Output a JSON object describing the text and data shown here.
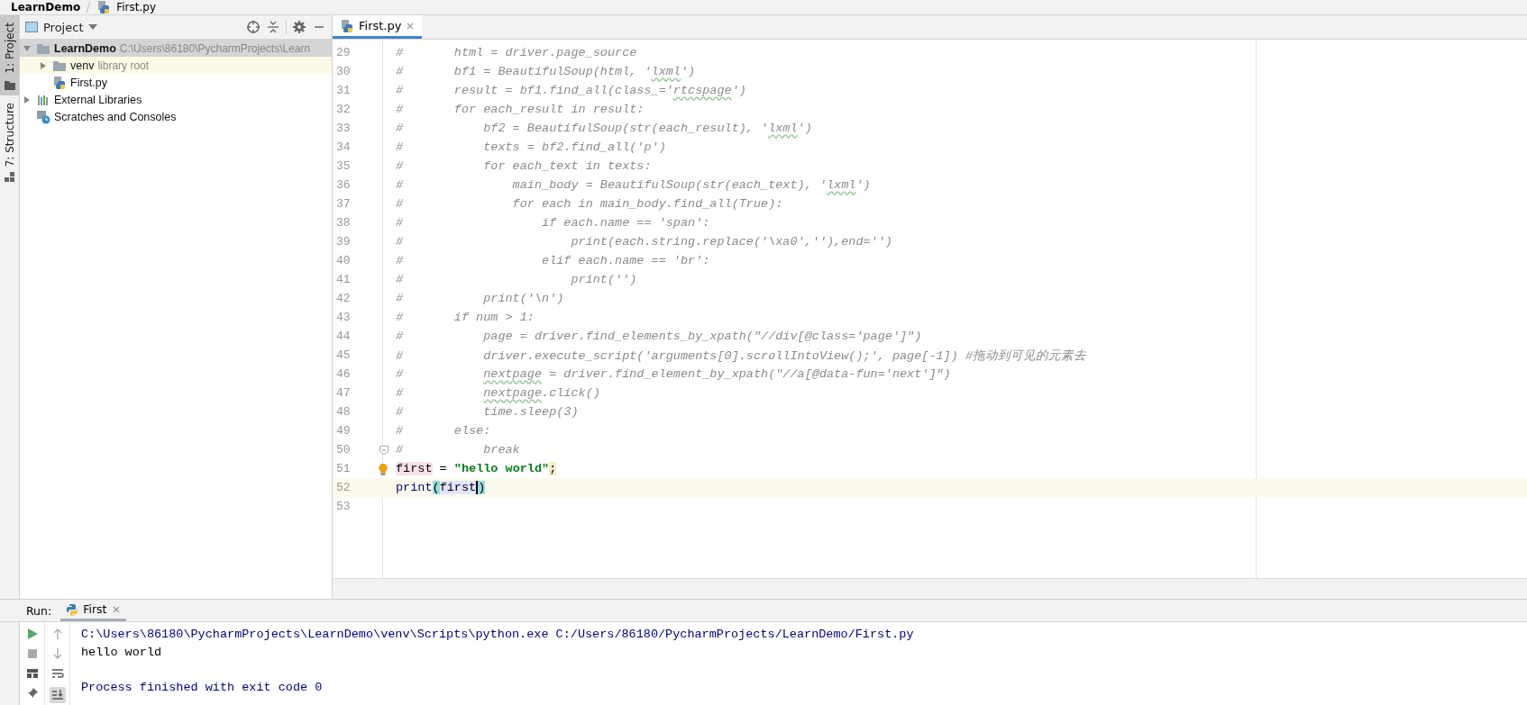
{
  "breadcrumb": [
    "LearnDemo",
    "First.py"
  ],
  "tool_strip": [
    {
      "label": "1: Project",
      "selected": true
    },
    {
      "label": "7: Structure",
      "selected": false
    }
  ],
  "project_panel": {
    "title": "Project",
    "tree": [
      {
        "name": "LearnDemo",
        "kind": "project-folder",
        "path": "C:\\Users\\86180\\PycharmProjects\\Learn",
        "expanded": true,
        "selected": true,
        "children": [
          {
            "name": "venv",
            "kind": "folder",
            "note": "library root",
            "expanded": false,
            "selected": false
          },
          {
            "name": "First.py",
            "kind": "python-file",
            "selected": false
          }
        ]
      },
      {
        "name": "External Libraries",
        "kind": "libraries",
        "expanded": false,
        "selected": false
      },
      {
        "name": "Scratches and Consoles",
        "kind": "scratches",
        "selected": false
      }
    ]
  },
  "editor": {
    "tabs": [
      {
        "label": "First.py",
        "selected": true
      }
    ],
    "lines": [
      {
        "number": "29",
        "current": false,
        "segments": [
          {
            "kind": "comment",
            "text": "#       html = driver.page_source"
          }
        ]
      },
      {
        "number": "30",
        "current": false,
        "segments": [
          {
            "kind": "comment",
            "text": "#       bf1 = BeautifulSoup(html, '"
          },
          {
            "kind": "typo",
            "text": "lxml"
          },
          {
            "kind": "comment",
            "text": "')"
          }
        ]
      },
      {
        "number": "31",
        "current": false,
        "segments": [
          {
            "kind": "comment",
            "text": "#       result = bf1.find_all(class_='"
          },
          {
            "kind": "typo",
            "text": "rtcspage"
          },
          {
            "kind": "comment",
            "text": "')"
          }
        ]
      },
      {
        "number": "32",
        "current": false,
        "segments": [
          {
            "kind": "comment",
            "text": "#       for each_result in result:"
          }
        ]
      },
      {
        "number": "33",
        "current": false,
        "segments": [
          {
            "kind": "comment",
            "text": "#           bf2 = BeautifulSoup(str(each_result), '"
          },
          {
            "kind": "typo",
            "text": "lxml"
          },
          {
            "kind": "comment",
            "text": "')"
          }
        ]
      },
      {
        "number": "34",
        "current": false,
        "segments": [
          {
            "kind": "comment",
            "text": "#           texts = bf2.find_all('p')"
          }
        ]
      },
      {
        "number": "35",
        "current": false,
        "segments": [
          {
            "kind": "comment",
            "text": "#           for each_text in texts:"
          }
        ]
      },
      {
        "number": "36",
        "current": false,
        "segments": [
          {
            "kind": "comment",
            "text": "#               main_body = BeautifulSoup(str(each_text), '"
          },
          {
            "kind": "typo",
            "text": "lxml"
          },
          {
            "kind": "comment",
            "text": "')"
          }
        ]
      },
      {
        "number": "37",
        "current": false,
        "segments": [
          {
            "kind": "comment",
            "text": "#               for each in main_body.find_all(True):"
          }
        ]
      },
      {
        "number": "38",
        "current": false,
        "segments": [
          {
            "kind": "comment",
            "text": "#                   if each.name == 'span':"
          }
        ]
      },
      {
        "number": "39",
        "current": false,
        "segments": [
          {
            "kind": "comment",
            "text": "#                       print(each.string.replace('\\xa0',''),end='')"
          }
        ]
      },
      {
        "number": "40",
        "current": false,
        "segments": [
          {
            "kind": "comment",
            "text": "#                   elif each.name == 'br':"
          }
        ]
      },
      {
        "number": "41",
        "current": false,
        "segments": [
          {
            "kind": "comment",
            "text": "#                       print('')"
          }
        ]
      },
      {
        "number": "42",
        "current": false,
        "segments": [
          {
            "kind": "comment",
            "text": "#           print('\\n')"
          }
        ]
      },
      {
        "number": "43",
        "current": false,
        "segments": [
          {
            "kind": "comment",
            "text": "#       if num > 1:"
          }
        ]
      },
      {
        "number": "44",
        "current": false,
        "segments": [
          {
            "kind": "comment",
            "text": "#           page = driver.find_elements_by_xpath(\"//div[@class='page']\")"
          }
        ]
      },
      {
        "number": "45",
        "current": false,
        "segments": [
          {
            "kind": "comment",
            "text": "#           driver.execute_script('arguments[0].scrollIntoView();', page[-1]) #拖动到可见的元素去"
          }
        ]
      },
      {
        "number": "46",
        "current": false,
        "segments": [
          {
            "kind": "comment",
            "text": "#           "
          },
          {
            "kind": "typo",
            "text": "nextpage"
          },
          {
            "kind": "comment",
            "text": " = driver.find_element_by_xpath(\"//a[@data-fun='next']\")"
          }
        ]
      },
      {
        "number": "47",
        "current": false,
        "segments": [
          {
            "kind": "comment",
            "text": "#           "
          },
          {
            "kind": "typo",
            "text": "nextpage"
          },
          {
            "kind": "comment",
            "text": ".click()"
          }
        ]
      },
      {
        "number": "48",
        "current": false,
        "segments": [
          {
            "kind": "comment",
            "text": "#           time.sleep(3)"
          }
        ]
      },
      {
        "number": "49",
        "current": false,
        "segments": [
          {
            "kind": "comment",
            "text": "#       else:"
          }
        ]
      },
      {
        "number": "50",
        "current": false,
        "fold": true,
        "segments": [
          {
            "kind": "comment",
            "text": "#           break"
          }
        ]
      },
      {
        "number": "51",
        "current": false,
        "intention": true,
        "segments": [
          {
            "kind": "write-usage",
            "text": "first"
          },
          {
            "kind": "plain",
            "text": " = "
          },
          {
            "kind": "string",
            "text": "\"hello world\""
          },
          {
            "kind": "warning",
            "text": ";"
          }
        ]
      },
      {
        "number": "52",
        "current": true,
        "segments": [
          {
            "kind": "builtin",
            "text": "print"
          },
          {
            "kind": "brace",
            "text": "("
          },
          {
            "kind": "read-usage",
            "text": "first",
            "caret": true
          },
          {
            "kind": "brace",
            "text": ")"
          }
        ]
      },
      {
        "number": "53",
        "current": false
      }
    ]
  },
  "run_panel": {
    "title": "Run:",
    "tabs": [
      {
        "label": "First",
        "selected": true
      }
    ],
    "output": [
      {
        "kind": "command",
        "text": "C:\\Users\\86180\\PycharmProjects\\LearnDemo\\venv\\Scripts\\python.exe C:/Users/86180/PycharmProjects/LearnDemo/First.py"
      },
      {
        "kind": "stdout",
        "text": "hello world"
      },
      {
        "kind": "exit",
        "text": "Process finished with exit code 0"
      }
    ]
  }
}
